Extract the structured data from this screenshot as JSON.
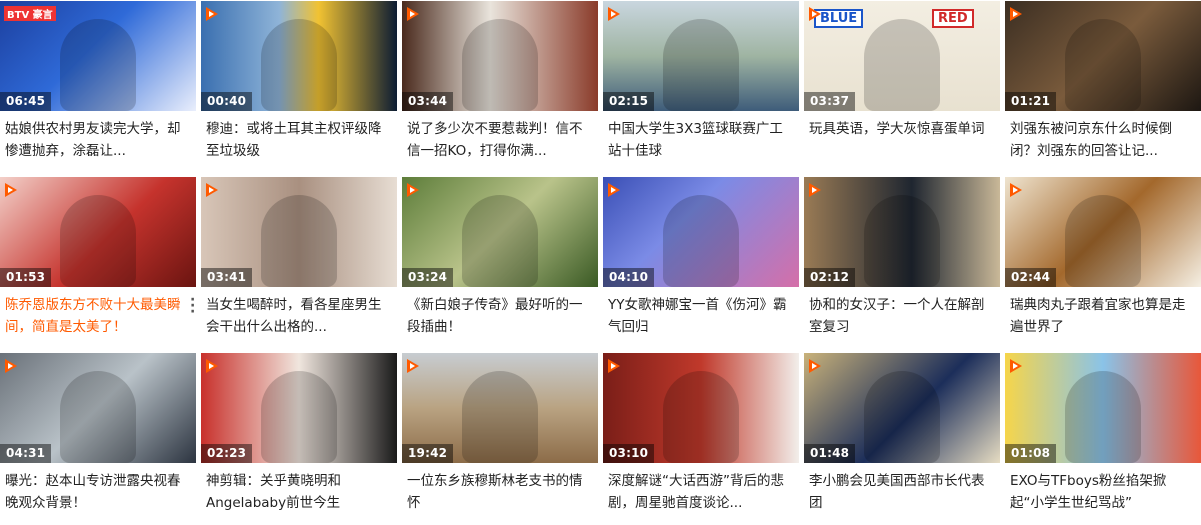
{
  "accent_color": "#ff5a00",
  "videos": [
    {
      "duration": "06:45",
      "title": "姑娘供农村男友读完大学，却惨遭抛弃，涂磊让...",
      "bg": "linear-gradient(135deg,#1c3f9e 0%,#2f6ad8 45%,#e9eefc 100%)",
      "overlay": "BTV 豪言"
    },
    {
      "duration": "00:40",
      "title": "穆迪：或将土耳其主权评级降至垃圾级",
      "bg": "linear-gradient(90deg,#3a6fb0 0%,#8fb4d8 40%,#f1c232 60%,#0c1c33 100%)",
      "overlay": ""
    },
    {
      "duration": "03:44",
      "title": "说了多少次不要惹裁判！信不信一招KO，打得你满...",
      "bg": "linear-gradient(90deg,#4a2a1d 0%,#e9e4dc 45%,#8a3b2a 100%)",
      "overlay": ""
    },
    {
      "duration": "02:15",
      "title": "中国大学生3X3篮球联赛广工站十佳球",
      "bg": "linear-gradient(180deg,#c9d6df 0%,#9fb4a2 50%,#3e5c7a 100%)",
      "overlay": ""
    },
    {
      "duration": "03:37",
      "title": "玩具英语，学大灰惊喜蛋单词",
      "bg": "linear-gradient(180deg,#f3eee2 0%,#e8e1d0 100%)",
      "overlay": "BLUE | RED"
    },
    {
      "duration": "01:21",
      "title": "刘强东被问京东什么时候倒闭？刘强东的回答让记...",
      "bg": "linear-gradient(135deg,#3b2e22 0%,#7a5b3c 50%,#1d1712 100%)",
      "overlay": ""
    },
    {
      "duration": "01:53",
      "title": "陈乔恩版东方不败十大最美瞬间，简直是太美了！",
      "bg": "linear-gradient(135deg,#f3d0c9 0%,#c5332d 55%,#6a1410 100%)",
      "overlay": "",
      "highlight": true,
      "more": true
    },
    {
      "duration": "03:41",
      "title": "当女生喝醉时，看各星座男生会干出什么出格的...",
      "bg": "linear-gradient(90deg,#d8c6b8 0%,#a99080 50%,#e7ddd3 100%)",
      "overlay": ""
    },
    {
      "duration": "03:24",
      "title": "《新白娘子传奇》最好听的一段插曲！",
      "bg": "linear-gradient(135deg,#5d7d3a 0%,#b9c38a 50%,#3a5a24 100%)",
      "overlay": ""
    },
    {
      "duration": "04:10",
      "title": "YY女歌神娜宝一首《伤河》霸气回归",
      "bg": "linear-gradient(135deg,#3a4fb5 0%,#7b8be6 40%,#d56fa8 100%)",
      "overlay": ""
    },
    {
      "duration": "02:12",
      "title": "协和的女汉子：一个人在解剖室复习",
      "bg": "linear-gradient(90deg,#9a7b55 0%,#1f2630 55%,#c9b898 100%)",
      "overlay": ""
    },
    {
      "duration": "02:44",
      "title": "瑞典肉丸子跟着宜家也算是走遍世界了",
      "bg": "linear-gradient(135deg,#efe4cf 0%,#a3682c 50%,#f5efe3 100%)",
      "overlay": ""
    },
    {
      "duration": "04:31",
      "title": "曝光：赵本山专访泄露央视春晚观众背景！",
      "bg": "linear-gradient(135deg,#6a7179 0%,#b9c2c8 50%,#2c3440 100%)",
      "overlay": ""
    },
    {
      "duration": "02:23",
      "title": "神剪辑：关乎黄晓明和Angelababy前世今生",
      "bg": "linear-gradient(90deg,#c8302b 0%,#f0e6de 50%,#1a1a1a 100%)",
      "overlay": ""
    },
    {
      "duration": "19:42",
      "title": "一位东乡族穆斯林老支书的情怀",
      "bg": "linear-gradient(180deg,#c7ccd1 0%,#b9a382 50%,#8c6c48 100%)",
      "overlay": ""
    },
    {
      "duration": "03:10",
      "title": "深度解谜“大话西游”背后的悲剧，周星驰首度谈论...",
      "bg": "linear-gradient(90deg,#7a1e18 0%,#c0392b 50%,#f2eeea 100%)",
      "overlay": ""
    },
    {
      "duration": "01:48",
      "title": "李小鹏会见美国西部市长代表团",
      "bg": "linear-gradient(135deg,#c9b27a 0%,#1c2e5a 55%,#e6dcc2 100%)",
      "overlay": ""
    },
    {
      "duration": "01:08",
      "title": "EXO与TFboys粉丝掐架掀起“小学生世纪骂战”",
      "bg": "linear-gradient(90deg,#f6d54a 0%,#8ac3e8 50%,#e8573a 100%)",
      "overlay": ""
    }
  ]
}
